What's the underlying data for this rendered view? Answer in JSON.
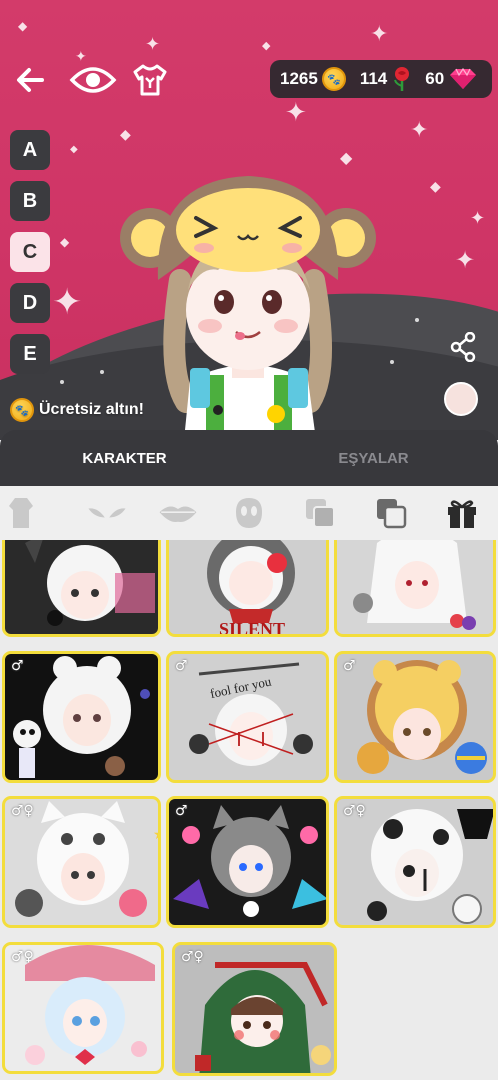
{
  "currency": {
    "gold": "1265",
    "roses": "114",
    "gems": "60"
  },
  "slots": [
    "A",
    "B",
    "C",
    "D",
    "E"
  ],
  "active_slot": "C",
  "free_gold_label": "Ücretsiz altın!",
  "tabs": [
    {
      "label": "KARAKTER",
      "active": true
    },
    {
      "label": "EŞYALAR",
      "active": false
    }
  ],
  "categories": [
    "body-icon",
    "eyes-icon",
    "lips-icon",
    "face-mask-icon",
    "layers-icon",
    "layers-alt-icon",
    "gift-icon"
  ],
  "cards": [
    {
      "theme": "gothic-doll"
    },
    {
      "theme": "silent-clown"
    },
    {
      "theme": "white-horned"
    },
    {
      "theme": "skeleton-bunny"
    },
    {
      "theme": "fool-for-you-clown"
    },
    {
      "theme": "lion-hood"
    },
    {
      "theme": "white-cat-hood"
    },
    {
      "theme": "grey-cat-punk"
    },
    {
      "theme": "cow-hood"
    },
    {
      "theme": "pink-umbrella-doll"
    },
    {
      "theme": "green-elf-hood"
    }
  ],
  "colors": {
    "scene_bg": "#d33b6a",
    "card_border": "#f3dd3c",
    "tab_bg": "#38383c"
  }
}
